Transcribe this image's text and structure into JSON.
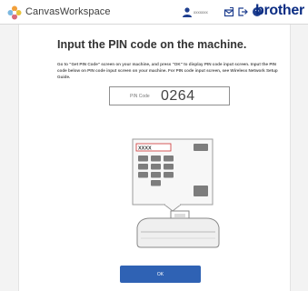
{
  "header": {
    "app_name": "CanvasWorkspace",
    "user_name": "xxxxxxx",
    "brand": "brother",
    "icons": [
      "user-icon",
      "mail-icon",
      "logout-icon",
      "help-icon"
    ]
  },
  "main": {
    "title": "Input the PIN code on the machine.",
    "instructions": "Go to \"Get PIN Code\" screen on your machine, and press \"OK\" to display PIN code input screen. Input the PIN code below on PIN code input screen on your machine. For PIN code input screen, see Wireless Network Setup Guide.",
    "pin_label": "PIN Code",
    "pin_value": "0264",
    "screen_placeholder": "XXXX",
    "ok_label": "OK"
  },
  "colors": {
    "brand": "#0c2d83",
    "accent": "#2f62b4",
    "background": "#f3f3f3"
  }
}
